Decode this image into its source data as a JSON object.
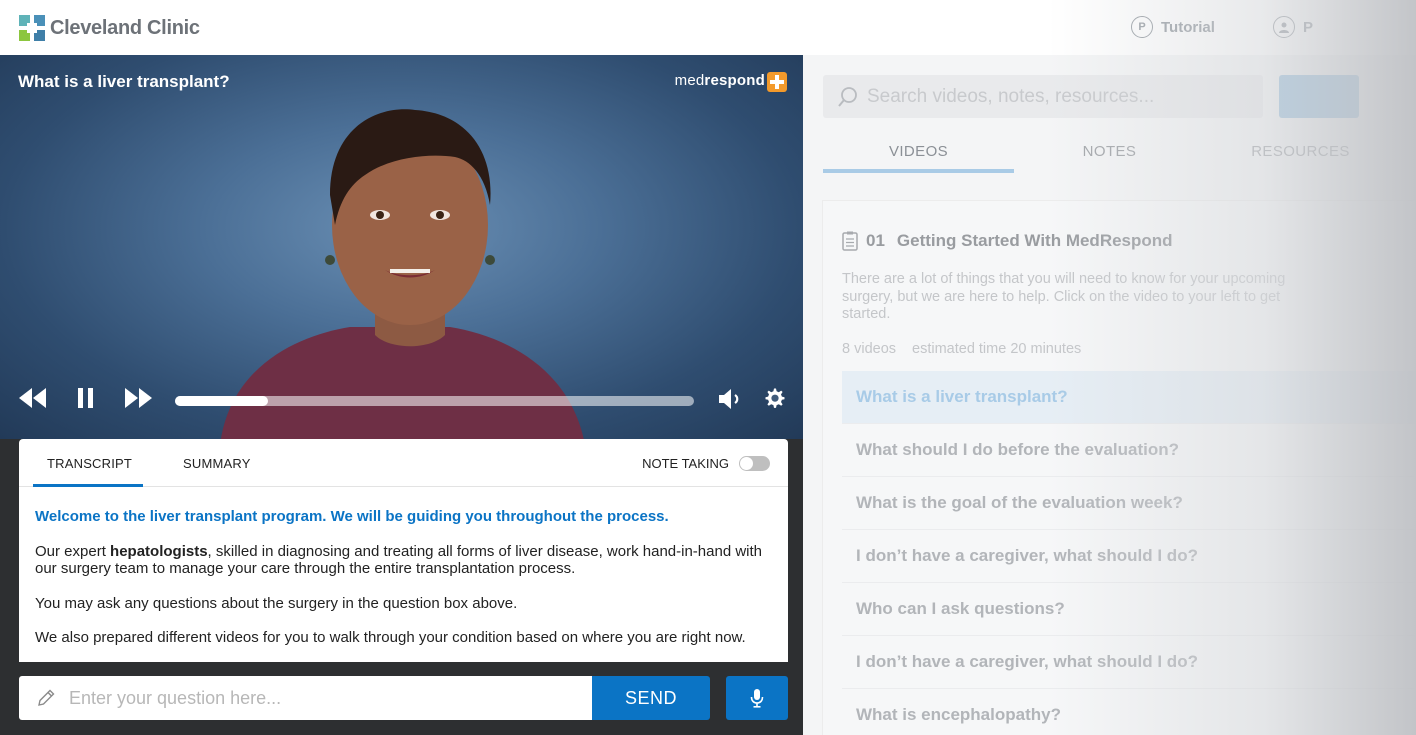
{
  "header": {
    "brand": "Cleveland Clinic",
    "tutorial_label": "Tutorial",
    "tutorial_icon_glyph": "P",
    "profile_partial_label": "P"
  },
  "video": {
    "title": "What is a liver transplant?",
    "brand_prefix": "med",
    "brand_bold": "respond",
    "progress_fraction": 0.18,
    "icons": [
      "rewind-icon",
      "pause-icon",
      "fast-forward-icon",
      "volume-icon",
      "settings-icon"
    ]
  },
  "transcript_card": {
    "tabs": [
      "TRANSCRIPT",
      "SUMMARY"
    ],
    "active_tab": "TRANSCRIPT",
    "note_taking_label": "NOTE TAKING",
    "note_taking_on": false,
    "lead": "Welcome to the liver transplant program. We will be guiding you throughout the process.",
    "para1_before": "Our expert ",
    "para1_bold": "hepatologists",
    "para1_after": ", skilled in diagnosing and treating all forms of liver disease, work hand-in-hand with our surgery team to manage your care through the entire transplantation process.",
    "para2": "You may ask any questions about the surgery in the question box above.",
    "para3": "We also prepared different videos for you to walk through your condition based on where you are right now."
  },
  "question_bar": {
    "placeholder": "Enter your question here...",
    "send_label": "SEND"
  },
  "right_panel": {
    "search_placeholder": "Search videos, notes, resources...",
    "tabs": [
      "VIDEOS",
      "NOTES",
      "RESOURCES"
    ],
    "active_tab": "VIDEOS",
    "module": {
      "number": "01",
      "title": "Getting Started With MedRespond",
      "description": "There are a lot of things that you will need to know for your upcoming surgery, but we are here to help. Click on the video to your left to get started.",
      "video_count": "8 videos",
      "estimated_time": "estimated time 20 minutes",
      "videos": [
        "What is a liver transplant?",
        "What should I do before the evaluation?",
        "What is the goal of the evaluation week?",
        "I don’t have a caregiver, what should I do?",
        "Who can I ask questions?",
        "I don’t have a caregiver, what should I do?",
        "What is encephalopathy?"
      ],
      "active_index": 0
    }
  },
  "colors": {
    "accent": "#0b74c5",
    "dark_panel": "#2d2f31",
    "brand_orange": "#f39a2b",
    "logo_teal": "#5fb3b8",
    "logo_green": "#8cc63f"
  }
}
